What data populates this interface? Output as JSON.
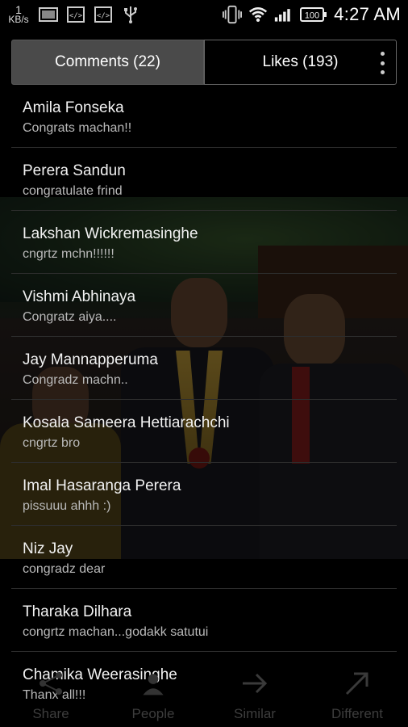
{
  "status_bar": {
    "net_speed_value": "1",
    "net_speed_unit": "KB/s",
    "battery": "100",
    "time": "4:27 AM",
    "icons": [
      "photo-icon",
      "code-icon",
      "code-icon",
      "usb-icon",
      "vibrate-icon",
      "wifi-icon",
      "signal-icon",
      "battery-icon"
    ]
  },
  "tabs": {
    "comments_label": "Comments (22)",
    "likes_label": "Likes (193)"
  },
  "comments": [
    {
      "name": "Amila Fonseka",
      "text": "Congrats machan!!"
    },
    {
      "name": "Perera Sandun",
      "text": "congratulate  frind"
    },
    {
      "name": "Lakshan Wickremasinghe",
      "text": "cngrtz mchn!!!!!!"
    },
    {
      "name": "Vishmi Abhinaya",
      "text": "Congratz aiya...."
    },
    {
      "name": "Jay Mannapperuma",
      "text": "Congradz machn.."
    },
    {
      "name": "Kosala Sameera Hettiarachchi",
      "text": "cngrtz bro"
    },
    {
      "name": "Imal Hasaranga Perera",
      "text": "pissuuu ahhh :)"
    },
    {
      "name": "Niz Jay",
      "text": "congradz dear"
    },
    {
      "name": "Tharaka Dilhara",
      "text": "congrtz machan...godakk satutui"
    },
    {
      "name": "Chamika Weerasinghe",
      "text": "Thanx all!!!"
    }
  ],
  "actions": {
    "share_label": "Share",
    "people_label": "People",
    "similar_label": "Similar",
    "different_label": "Different"
  },
  "colors": {
    "background": "#000000",
    "active_tab": "#4a4a4a",
    "divider": "#2d2d2d",
    "comment_text": "#b9b9b9"
  }
}
